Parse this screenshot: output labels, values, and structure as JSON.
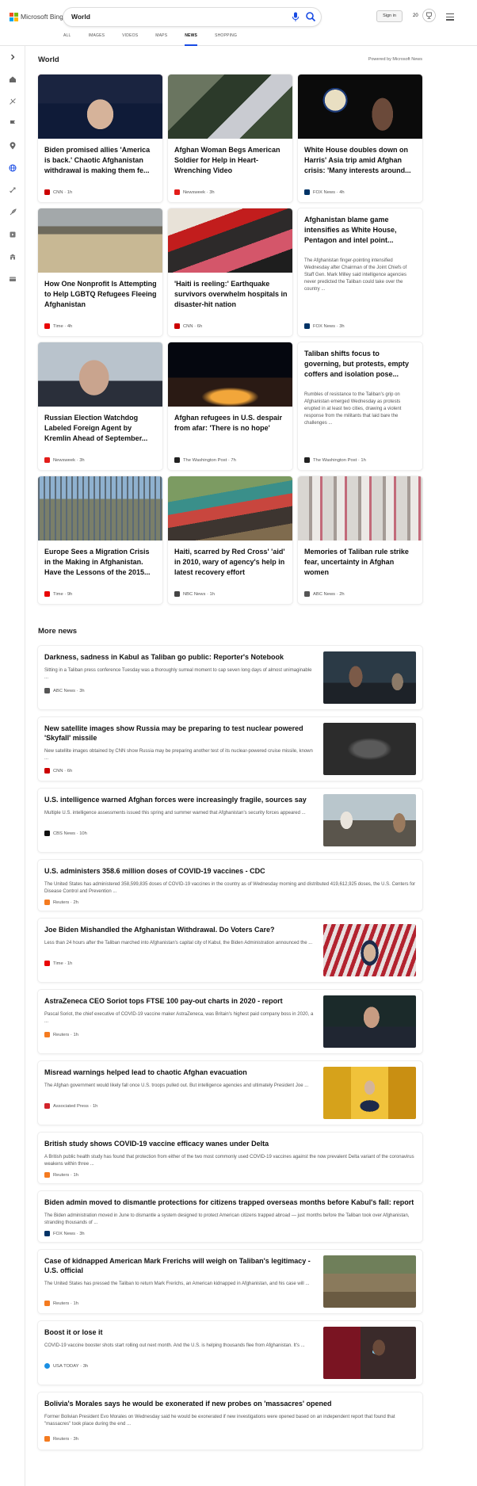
{
  "header": {
    "brand": "Microsoft Bing",
    "query": "World",
    "signin": "Sign in",
    "rewards_points": "20",
    "tabs": [
      "ALL",
      "IMAGES",
      "VIDEOS",
      "MAPS",
      "NEWS",
      "SHOPPING"
    ],
    "active_tab": "NEWS"
  },
  "colors": {
    "accent": "#174ae4",
    "logo": [
      "#f25022",
      "#7fba00",
      "#00a4ef",
      "#ffb900"
    ]
  },
  "world": {
    "title": "World",
    "powered_by": "Powered by Microsoft News",
    "cards": [
      {
        "title": "Biden promised allies 'America is back.' Chaotic Afghanistan withdrawal is making them fe...",
        "source": "CNN",
        "time": "1h",
        "icon_color": "#cc0000"
      },
      {
        "title": "Afghan Woman Begs American Soldier for Help in Heart-Wrenching Video",
        "source": "Newsweek",
        "time": "3h",
        "icon_color": "#e31d1a"
      },
      {
        "title": "White House doubles down on Harris' Asia trip amid Afghan crisis: 'Many interests around...",
        "source": "FOX News",
        "time": "4h",
        "icon_color": "#003366"
      },
      {
        "title": "How One Nonprofit Is Attempting to Help LGBTQ Refugees Fleeing Afghanistan",
        "source": "Time",
        "time": "4h",
        "icon_color": "#e90606"
      },
      {
        "title": "'Haiti is reeling:' Earthquake survivors overwhelm hospitals in disaster-hit nation",
        "source": "CNN",
        "time": "6h",
        "icon_color": "#cc0000"
      },
      {
        "title": "Afghanistan blame game intensifies as White House, Pentagon and intel point...",
        "snippet": "The Afghanistan finger-pointing intensified Wednesday after Chairman of the Joint Chiefs of Staff Gen. Mark Milley said intelligence agencies never predicted the Taliban could take over the country ...",
        "source": "FOX News",
        "time": "3h",
        "icon_color": "#003366"
      },
      {
        "title": "Russian Election Watchdog Labeled Foreign Agent by Kremlin Ahead of September...",
        "source": "Newsweek",
        "time": "3h",
        "icon_color": "#e31d1a"
      },
      {
        "title": "Afghan refugees in U.S. despair from afar: 'There is no hope'",
        "source": "The Washington Post",
        "time": "7h",
        "icon_color": "#222222"
      },
      {
        "title": "Taliban shifts focus to governing, but protests, empty coffers and isolation pose...",
        "snippet": "Rumbles of resistance to the Taliban's grip on Afghanistan emerged Wednesday as protests erupted in at least two cities, drawing a violent response from the militants that laid bare the challenges ...",
        "source": "The Washington Post",
        "time": "1h",
        "icon_color": "#222222"
      },
      {
        "title": "Europe Sees a Migration Crisis in the Making in Afghanistan. Have the Lessons of the 2015...",
        "source": "Time",
        "time": "9h",
        "icon_color": "#e90606"
      },
      {
        "title": "Haiti, scarred by Red Cross' 'aid' in 2010, wary of agency's help in latest recovery effort",
        "source": "NBC News",
        "time": "1h",
        "icon_color": "#444444"
      },
      {
        "title": "Memories of Taliban rule strike fear, uncertainty in Afghan women",
        "source": "ABC News",
        "time": "2h",
        "icon_color": "#555555"
      }
    ]
  },
  "more_news": {
    "title": "More news",
    "items": [
      {
        "title": "Darkness, sadness in Kabul as Taliban go public: Reporter's Notebook",
        "snippet": "Sitting in a Taliban press conference Tuesday was a thoroughly surreal moment to cap seven long days of almost unimaginable ...",
        "source": "ABC News",
        "time": "3h",
        "icon_color": "#555555"
      },
      {
        "title": "New satellite images show Russia may be preparing to test nuclear powered 'Skyfall' missile",
        "snippet": "New satellite images obtained by CNN show Russia may be preparing another test of its nuclear-powered cruise missile, known ...",
        "source": "CNN",
        "time": "6h",
        "icon_color": "#cc0000"
      },
      {
        "title": "U.S. intelligence warned Afghan forces were increasingly fragile, sources say",
        "snippet": "Multiple U.S. intelligence assessments issued this spring and summer warned that Afghanistan's security forces appeared ...",
        "source": "CBS News",
        "time": "10h",
        "icon_color": "#111111"
      },
      {
        "title": "U.S. administers 358.6 million doses of COVID-19 vaccines - CDC",
        "snippet": "The United States has administered 358,599,835 doses of COVID-19 vaccines in the country as of Wednesday morning and distributed 419,612,925 doses, the U.S. Centers for Disease Control and Prevention ...",
        "source": "Reuters",
        "time": "2h",
        "icon_color": "#f47b20"
      },
      {
        "title": "Joe Biden Mishandled the Afghanistan Withdrawal. Do Voters Care?",
        "snippet": "Less than 24 hours after the Taliban marched into Afghanistan's capital city of Kabul, the Biden Administration announced the ...",
        "source": "Time",
        "time": "1h",
        "icon_color": "#e90606"
      },
      {
        "title": "AstraZeneca CEO Soriot tops FTSE 100 pay-out charts in 2020 - report",
        "snippet": "Pascal Soriot, the chief executive of COVID-19 vaccine maker AstraZeneca, was Britain's highest paid company boss in 2020, a ...",
        "source": "Reuters",
        "time": "1h",
        "icon_color": "#f47b20"
      },
      {
        "title": "Misread warnings helped lead to chaotic Afghan evacuation",
        "snippet": "The Afghan government would likely fall once U.S. troops pulled out. But intelligence agencies and ultimately President Joe ...",
        "source": "Associated Press",
        "time": "1h",
        "icon_color": "#d2232a"
      },
      {
        "title": "British study shows COVID-19 vaccine efficacy wanes under Delta",
        "snippet": "A British public health study has found that protection from either of the two most commonly used COVID-19 vaccines against the now prevalent Delta variant of the coronavirus weakens within three ...",
        "source": "Reuters",
        "time": "1h",
        "icon_color": "#f47b20"
      },
      {
        "title": "Biden admin moved to dismantle protections for citizens trapped overseas months before Kabul's fall: report",
        "snippet": "The Biden administration moved in June to dismantle a system designed to protect American citizens trapped abroad — just months before the Taliban took over Afghanistan, stranding thousands of ...",
        "source": "FOX News",
        "time": "3h",
        "icon_color": "#003366"
      },
      {
        "title": "Case of kidnapped American Mark Frerichs will weigh on Taliban's legitimacy - U.S. official",
        "snippet": "The United States has pressed the Taliban to return Mark Frerichs, an American kidnapped in Afghanistan, and his case will ...",
        "source": "Reuters",
        "time": "1h",
        "icon_color": "#f47b20"
      },
      {
        "title": "Boost it or lose it",
        "snippet": "COVID-19 vaccine booster shots start rolling out next month. And the U.S. is helping thousands flee from Afghanistan. It's ...",
        "source": "USA TODAY",
        "time": "3h",
        "icon_color": "#1a8fe3"
      },
      {
        "title": "Bolivia's Morales says he would be exonerated if new probes on 'massacres' opened",
        "snippet": "Former Bolivian President Evo Morales on Wednesday said he would be exonerated if new investigations were opened based on an independent report that found that \"massacres\" took place during the end ...",
        "source": "Reuters",
        "time": "3h",
        "icon_color": "#f47b20"
      }
    ]
  }
}
